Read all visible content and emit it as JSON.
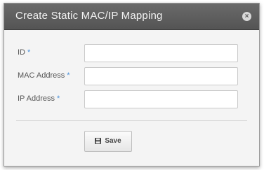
{
  "dialog": {
    "title": "Create Static MAC/IP Mapping",
    "close_glyph": "×"
  },
  "form": {
    "fields": [
      {
        "label": "ID",
        "required_marker": "*",
        "value": ""
      },
      {
        "label": "MAC Address",
        "required_marker": "*",
        "value": ""
      },
      {
        "label": "IP Address",
        "required_marker": "*",
        "value": ""
      }
    ]
  },
  "actions": {
    "save_label": "Save",
    "save_icon": "floppy-disk-icon"
  },
  "colors": {
    "titlebar": "#5e5e5e",
    "required_marker": "#4a90d9",
    "dialog_background": "#f4f4f4"
  }
}
